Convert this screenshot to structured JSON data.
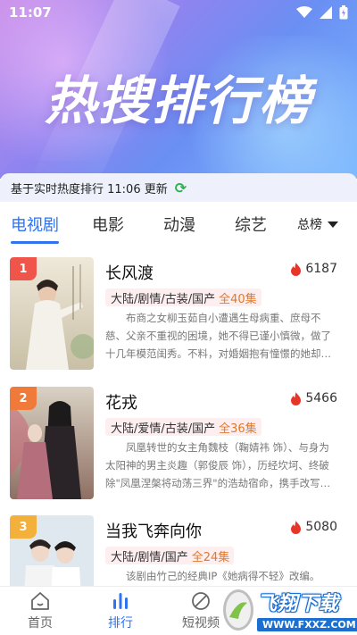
{
  "status_bar": {
    "time": "11:07"
  },
  "hero": {
    "title": "热搜排行榜"
  },
  "update_bar": {
    "text": "基于实时热度排行 11:06 更新"
  },
  "tabs": [
    {
      "label": "电视剧",
      "active": true
    },
    {
      "label": "电影",
      "active": false
    },
    {
      "label": "动漫",
      "active": false
    },
    {
      "label": "综艺",
      "active": false
    }
  ],
  "rank_dropdown": {
    "label": "总榜"
  },
  "items": [
    {
      "rank": "1",
      "badge_color": "#f0554c",
      "title": "长风渡",
      "heat": "6187",
      "category": "大陆/剧情/古装/国产",
      "episodes": "全40集",
      "description": "布商之女柳玉茹自小遭遇生母病重、庶母不慈、父亲不重视的困境，她不得已谨小慎微，做了十几年模范闺秀。不料，对婚姻抱有憧憬的她却被家里安排..."
    },
    {
      "rank": "2",
      "badge_color": "#f07a3a",
      "title": "花戎",
      "heat": "5466",
      "category": "大陆/爱情/古装/国产",
      "episodes": "全36集",
      "description": "凤凰转世的女主角魏枝（鞠婧祎 饰）、与身为太阳神的男主炎趣（郭俊辰 饰），历经坎坷、终破除\"凤凰涅槃将动荡三界\"的浩劫宿命，携手改写天道..."
    },
    {
      "rank": "3",
      "badge_color": "#f3b13b",
      "title": "当我飞奔向你",
      "heat": "5080",
      "category": "大陆/剧情/国产",
      "episodes": "全24集",
      "description": "该剧由竹己的经典IP《她病得不轻》改编。"
    }
  ],
  "bottom_nav": [
    {
      "label": "首页",
      "icon": "home-icon",
      "active": false
    },
    {
      "label": "排行",
      "icon": "ranking-icon",
      "active": true
    },
    {
      "label": "短视频",
      "icon": "short-video-icon",
      "active": false
    }
  ],
  "watermark": {
    "text": "飞翔下载",
    "url": "WWW.FXXZ.COM"
  },
  "colors": {
    "accent": "#2f73f0",
    "flame": "#e8352a",
    "episodes": "#e07a2c",
    "refresh": "#2bb24c"
  }
}
